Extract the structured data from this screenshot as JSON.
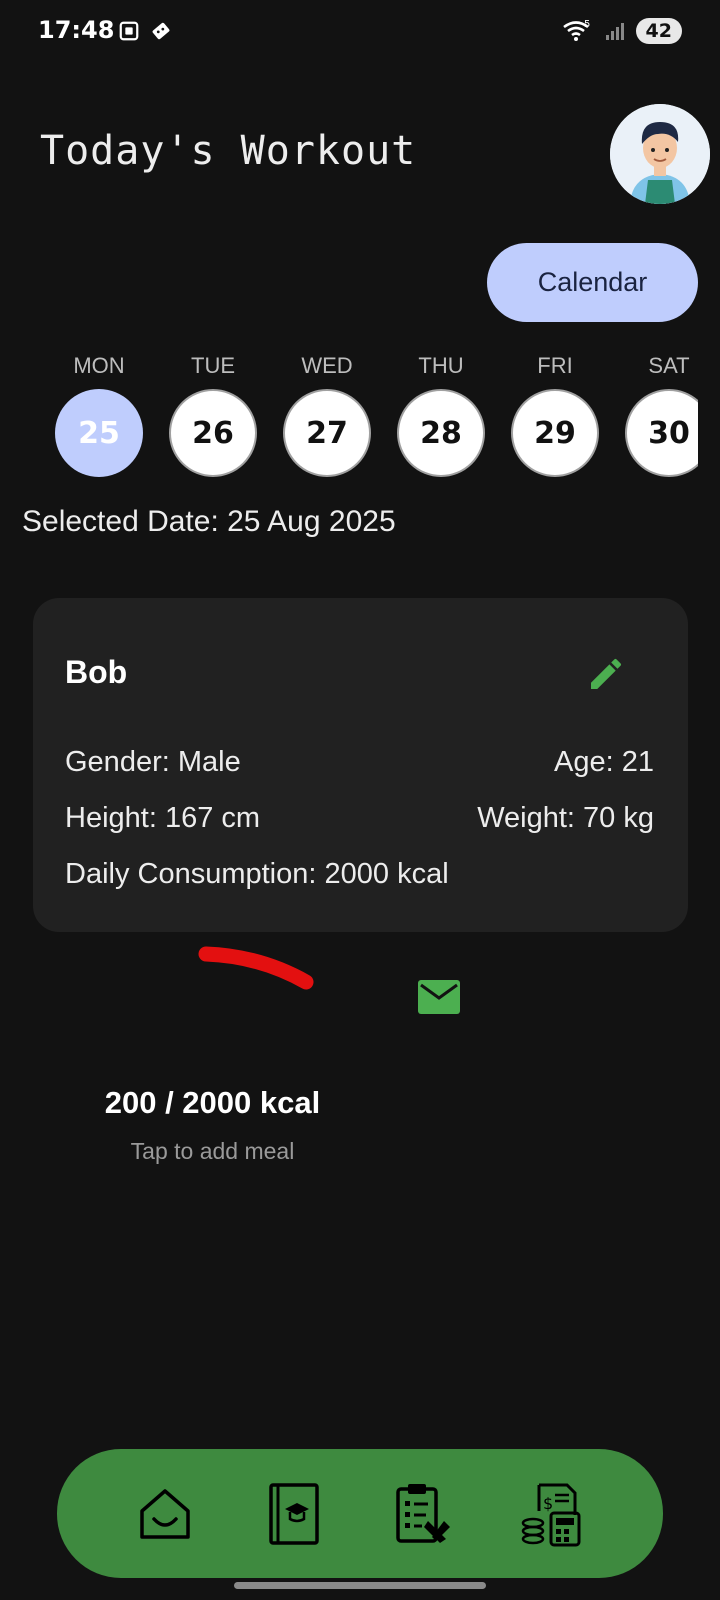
{
  "status_bar": {
    "time": "17:48",
    "battery": "42",
    "wifi_badge": "5",
    "left_icons": [
      "screenshot-icon",
      "dice-icon"
    ],
    "right_icons": [
      "wifi-icon",
      "signal-icon",
      "battery-icon"
    ]
  },
  "header": {
    "title": "Today's Workout",
    "avatar_icon": "avatar"
  },
  "calendar": {
    "button_label": "Calendar",
    "days": [
      {
        "name": "MON",
        "date": "25",
        "selected": true
      },
      {
        "name": "TUE",
        "date": "26",
        "selected": false
      },
      {
        "name": "WED",
        "date": "27",
        "selected": false
      },
      {
        "name": "THU",
        "date": "28",
        "selected": false
      },
      {
        "name": "FRI",
        "date": "29",
        "selected": false
      },
      {
        "name": "SAT",
        "date": "30",
        "selected": false
      }
    ],
    "selected_date_text": "Selected Date: 25 Aug 2025"
  },
  "profile": {
    "name": "Bob",
    "gender": "Gender: Male",
    "age": "Age: 21",
    "height": "Height: 167 cm",
    "weight": "Weight: 70 kg",
    "daily": "Daily Consumption: 2000 kcal",
    "edit_icon": "pencil-icon"
  },
  "calories": {
    "consumed_text": "200 / 2000 kcal",
    "hint": "Tap to add meal",
    "progress_fraction": 0.1,
    "mail_icon": "mail-icon"
  },
  "bottom_nav": {
    "items": [
      "home-icon",
      "book-icon",
      "clipboard-icon",
      "finance-calculator-icon"
    ]
  },
  "colors": {
    "background": "#121212",
    "accent_blue": "#bfcdfd",
    "accent_green": "#3e8a3f",
    "icon_green": "#4caf50",
    "progress_red": "#e31010",
    "card": "#212121"
  }
}
